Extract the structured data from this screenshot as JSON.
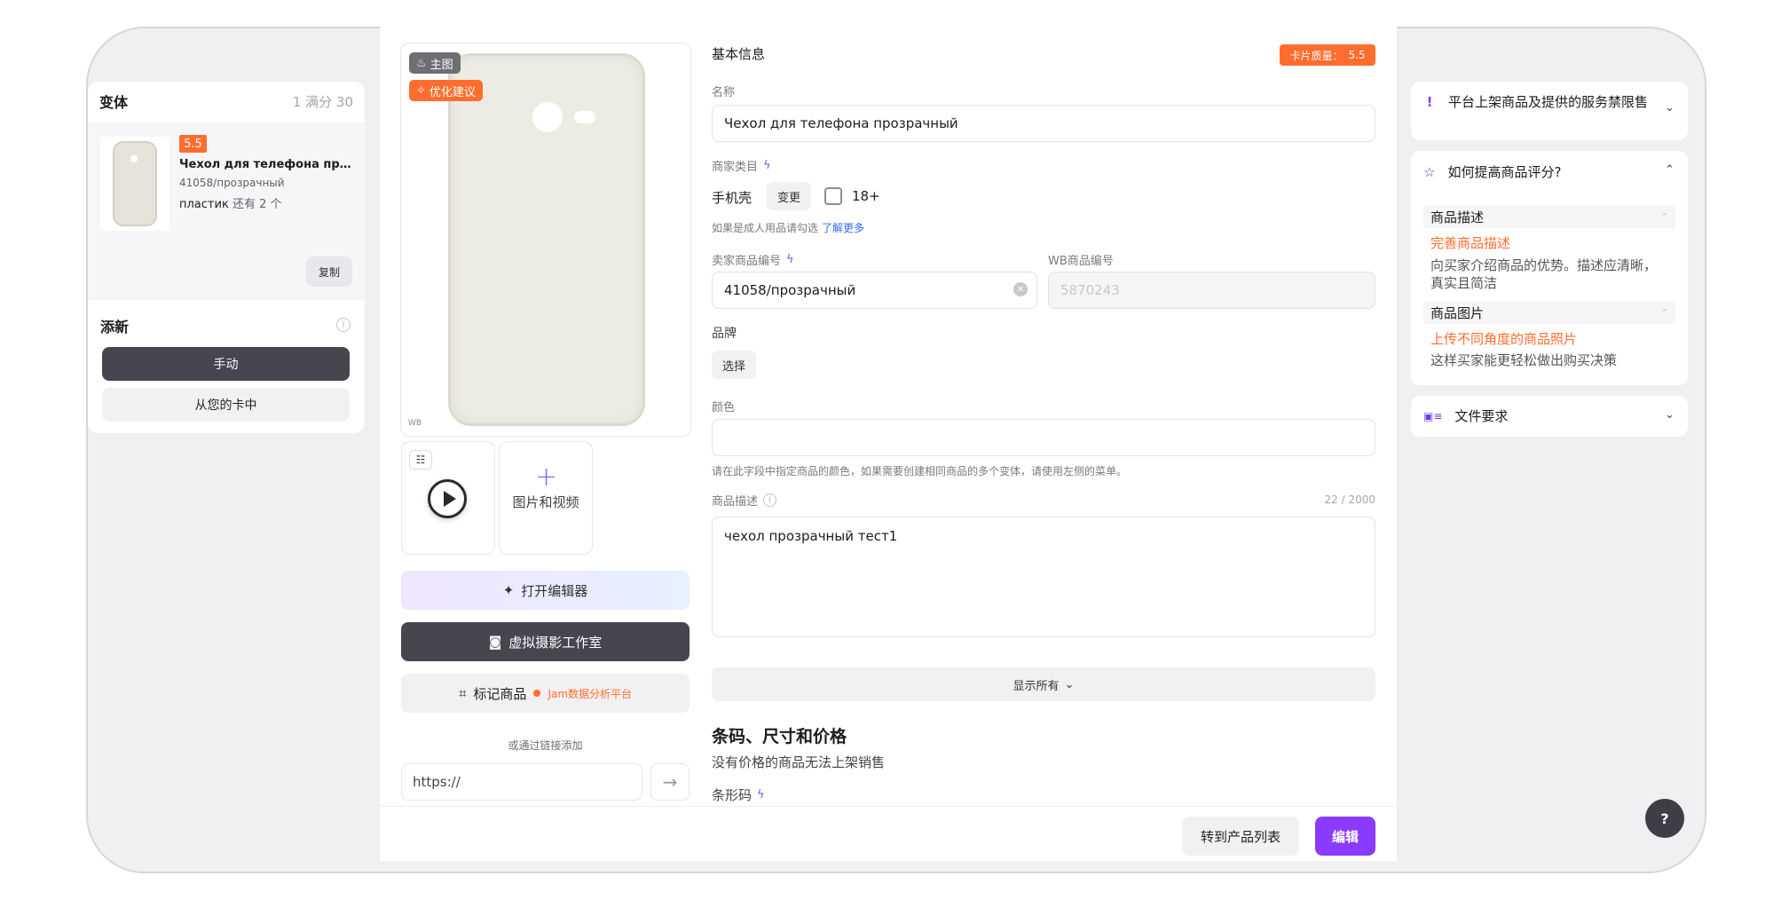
{
  "variants": {
    "title": "变体",
    "count": "1 满分 30",
    "item": {
      "score": "5.5",
      "name": "Чехол для телефона прозрач...",
      "sku": "41058/прозрачный",
      "material": "пластик",
      "stock": "还有 2 个",
      "copy_label": "复制"
    },
    "add": {
      "title": "添新",
      "info": "i",
      "manual_label": "手动",
      "from_card_label": "从您的卡中"
    }
  },
  "media": {
    "main_tag": "主图",
    "optimize_tag": "优化建议",
    "watermark": "WB",
    "add_media_label": "图片和视频",
    "open_editor_label": "打开编辑器",
    "virtual_studio_label": "虚拟摄影工作室",
    "mark_product_label": "标记商品",
    "jam_label": "Jam数据分析平台",
    "or_link_label": "或通过链接添加",
    "url_value": "https://"
  },
  "form": {
    "section_title": "基本信息",
    "quality_label": "卡片质量：",
    "quality_value": "5.5",
    "name_label": "名称",
    "name_value": "Чехол для телефона прозрачный",
    "category_label": "商家类目",
    "category_value": "手机壳",
    "change_label": "变更",
    "adult_label": "18+",
    "adult_hint": "如果是成人用品请勾选",
    "learn_more": "了解更多",
    "seller_sku_label": "卖家商品编号",
    "seller_sku_value": "41058/прозрачный",
    "wb_sku_label": "WB商品编号",
    "wb_sku_value": "5870243",
    "brand_label": "品牌",
    "brand_button": "选择",
    "color_label": "颜色",
    "color_value": "",
    "color_hint": "请在此字段中指定商品的颜色，如果需要创建相同商品的多个变体，请使用左侧的菜单。",
    "desc_label": "商品描述",
    "desc_counter": "22 / 2000",
    "desc_value": "чехол прозрачный тест1",
    "show_all_label": "显示所有",
    "barcode_section_title": "条码、尺寸和价格",
    "barcode_section_desc": "没有价格的商品无法上架销售",
    "barcode_label": "条形码"
  },
  "footer": {
    "to_list_label": "转到产品列表",
    "edit_label": "编辑"
  },
  "tips": {
    "restricted_title": "平台上架商品及提供的服务禁限售",
    "improve_title": "如何提高商品评分?",
    "desc_section": "商品描述",
    "desc_action": "完善商品描述",
    "desc_text": "向买家介绍商品的优势。描述应清晰，真实且简洁",
    "photo_section": "商品图片",
    "photo_action": "上传不同角度的商品照片",
    "photo_text": "这样买家能更轻松做出购买决策",
    "file_req_title": "文件要求",
    "help_label": "?"
  },
  "colors": {
    "accent": "#8a3bff",
    "orange": "#ff6d2e",
    "dark_button": "#46464e"
  }
}
